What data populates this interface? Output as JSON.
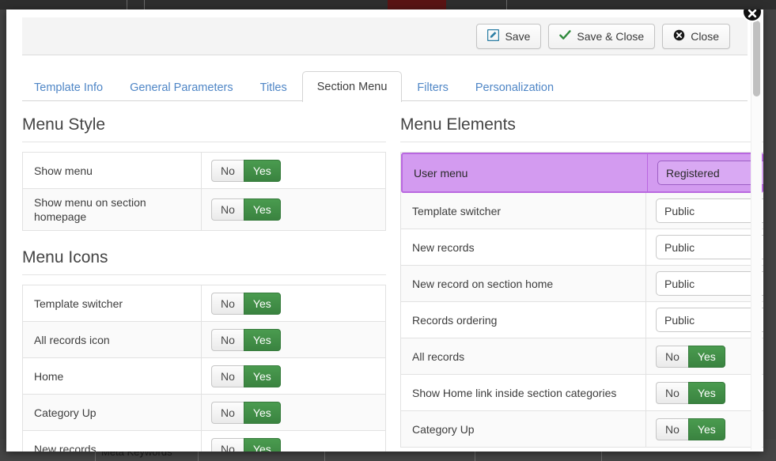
{
  "background": {
    "meta_keywords_label": "Meta Keywords"
  },
  "modal": {
    "close_icon": "close-circle-icon"
  },
  "toolbar": {
    "buttons": [
      {
        "label": "Save",
        "icon": "pencil-square-icon"
      },
      {
        "label": "Save & Close",
        "icon": "check-icon"
      },
      {
        "label": "Close",
        "icon": "close-circle-icon"
      }
    ]
  },
  "tabs": [
    {
      "label": "Template Info",
      "active": false
    },
    {
      "label": "General Parameters",
      "active": false
    },
    {
      "label": "Titles",
      "active": false
    },
    {
      "label": "Section Menu",
      "active": true
    },
    {
      "label": "Filters",
      "active": false
    },
    {
      "label": "Personalization",
      "active": false
    }
  ],
  "left_column": {
    "menu_style": {
      "title": "Menu Style",
      "rows": [
        {
          "label": "Show menu",
          "type": "toggle",
          "off": "No",
          "on": "Yes",
          "value": "Yes"
        },
        {
          "label": "Show menu on section homepage",
          "type": "toggle",
          "off": "No",
          "on": "Yes",
          "value": "Yes"
        }
      ]
    },
    "menu_icons": {
      "title": "Menu Icons",
      "rows": [
        {
          "label": "Template switcher",
          "type": "toggle",
          "off": "No",
          "on": "Yes",
          "value": "Yes"
        },
        {
          "label": "All records icon",
          "type": "toggle",
          "off": "No",
          "on": "Yes",
          "value": "Yes"
        },
        {
          "label": "Home",
          "type": "toggle",
          "off": "No",
          "on": "Yes",
          "value": "Yes"
        },
        {
          "label": "Category Up",
          "type": "toggle",
          "off": "No",
          "on": "Yes",
          "value": "Yes"
        },
        {
          "label": "New records",
          "type": "toggle",
          "off": "No",
          "on": "Yes",
          "value": "Yes"
        }
      ]
    }
  },
  "right_column": {
    "menu_elements": {
      "title": "Menu Elements",
      "rows": [
        {
          "label": "User menu",
          "type": "select",
          "value": "Registered",
          "highlighted": true
        },
        {
          "label": "Template switcher",
          "type": "select",
          "value": "Public",
          "highlighted": false
        },
        {
          "label": "New records",
          "type": "select",
          "value": "Public",
          "highlighted": false
        },
        {
          "label": "New record on section home",
          "type": "select",
          "value": "Public",
          "highlighted": false
        },
        {
          "label": "Records ordering",
          "type": "select",
          "value": "Public",
          "highlighted": false
        },
        {
          "label": "All records",
          "type": "toggle",
          "off": "No",
          "on": "Yes",
          "value": "Yes",
          "highlighted": false
        },
        {
          "label": "Show Home link inside section categories",
          "type": "toggle",
          "off": "No",
          "on": "Yes",
          "value": "Yes",
          "highlighted": false
        },
        {
          "label": "Category Up",
          "type": "toggle",
          "off": "No",
          "on": "Yes",
          "value": "Yes",
          "highlighted": false
        }
      ]
    }
  },
  "colors": {
    "accent_green": "#3a8340",
    "tab_link_blue": "#4f86c6",
    "highlight_purple": "#d39bf0",
    "highlight_purple_border": "#b968e0"
  }
}
